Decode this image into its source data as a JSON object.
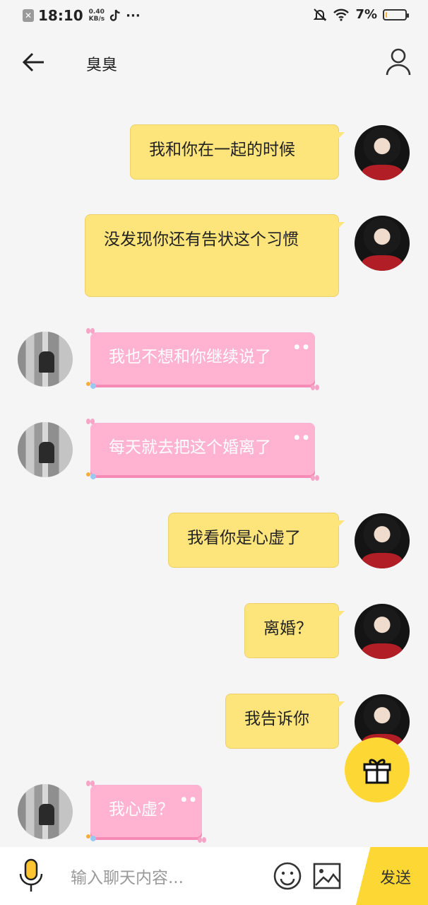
{
  "status_bar": {
    "time": "18:10",
    "speed_value": "0.40",
    "speed_unit": "KB/s",
    "dots": "···",
    "battery_percent": "7%",
    "battery_level": 0.07,
    "colors": {
      "battery_fill": "#f2b53a"
    }
  },
  "header": {
    "title": "臭臭",
    "back_icon": "arrow-left-icon",
    "profile_icon": "user-profile-icon"
  },
  "messages": [
    {
      "side": "me",
      "style": "yellow",
      "text": "我和你在一起的时候"
    },
    {
      "side": "me",
      "style": "yellow",
      "text": "没发现你还有告状这个习惯"
    },
    {
      "side": "other",
      "style": "pink",
      "text": "我也不想和你继续说了"
    },
    {
      "side": "other",
      "style": "pink",
      "text": "每天就去把这个婚离了"
    },
    {
      "side": "me",
      "style": "yellow",
      "text": "我看你是心虚了"
    },
    {
      "side": "me",
      "style": "yellow",
      "text": "离婚？"
    },
    {
      "side": "me",
      "style": "yellow",
      "text": "我告诉你"
    },
    {
      "side": "other",
      "style": "pink",
      "text": "我心虚？"
    }
  ],
  "gift_button": {
    "icon": "gift-icon"
  },
  "input_bar": {
    "placeholder": "输入聊天内容...",
    "send_label": "发送",
    "icons": [
      "microphone-icon",
      "emoji-icon",
      "image-icon"
    ]
  },
  "colors": {
    "yellow_bubble": "#fde57b",
    "pink_bubble": "#ffb3d1",
    "accent": "#fdd835",
    "background": "#f5f5f5"
  }
}
